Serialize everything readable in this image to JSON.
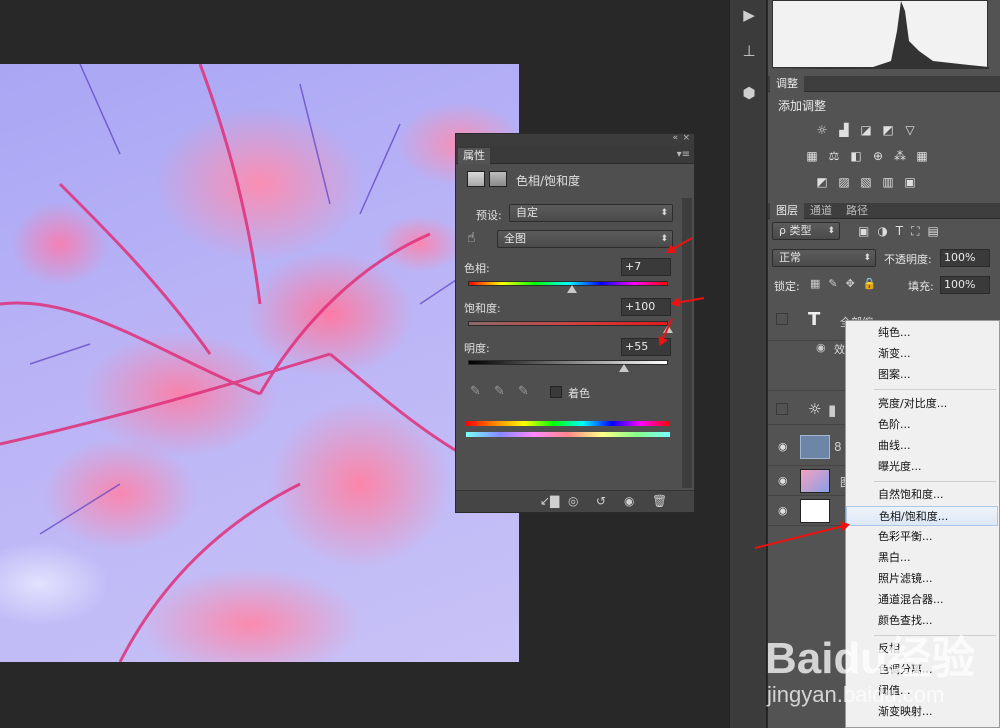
{
  "properties_panel": {
    "collapse_glyph": "«",
    "close_glyph": "×",
    "tab": "属性",
    "title": "色相/饱和度",
    "preset_label": "预设:",
    "preset_value": "自定",
    "channel_value": "全图",
    "hue_label": "色相:",
    "hue_value": "+7",
    "saturation_label": "饱和度:",
    "saturation_value": "+100",
    "lightness_label": "明度:",
    "lightness_value": "+55",
    "colorize_label": "着色",
    "hue_slider_position": 0.52,
    "saturation_slider_position": 1.0,
    "lightness_slider_position": 0.78
  },
  "adjustments_panel": {
    "tab": "调整",
    "subtitle": "添加调整"
  },
  "layers_panel": {
    "tabs": [
      "图层",
      "通道",
      "路径"
    ],
    "filter_label": "ρ 类型",
    "blend_mode": "正常",
    "opacity_label": "不透明度:",
    "opacity_value": "100%",
    "lock_label": "锁定:",
    "fill_label": "填充:",
    "fill_value": "100%",
    "layers": [
      {
        "name": "全部缩",
        "kind": "text"
      },
      {
        "name": "效",
        "kind": "effect"
      },
      {
        "name": "",
        "kind": "adjust"
      },
      {
        "name": "",
        "kind": "huesat"
      },
      {
        "name": "图",
        "kind": "image"
      },
      {
        "name": "",
        "kind": "white"
      }
    ]
  },
  "context_menu": {
    "items": [
      "纯色...",
      "渐变...",
      "图案...",
      "亮度/对比度...",
      "色阶...",
      "曲线...",
      "曝光度...",
      "自然饱和度...",
      "色相/饱和度...",
      "色彩平衡...",
      "黑白...",
      "照片滤镜...",
      "通道混合器...",
      "颜色查找...",
      "反相",
      "色调分离...",
      "阈值...",
      "渐变映射..."
    ],
    "highlighted": "色相/饱和度..."
  },
  "watermark": {
    "brand": "Baidu经验",
    "url": "jingyan.baidu.com"
  }
}
